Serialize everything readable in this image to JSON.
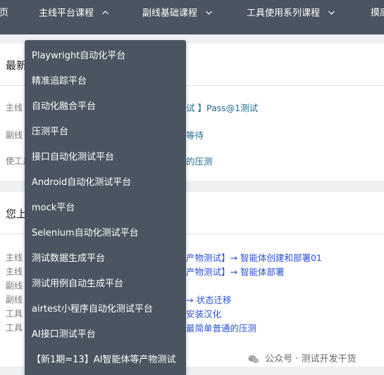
{
  "nav": {
    "items": [
      {
        "label": "页"
      },
      {
        "label": "主线平台课程",
        "chevron": "up"
      },
      {
        "label": "副线基础课程",
        "chevron": "down"
      },
      {
        "label": "工具使用系列课程",
        "chevron": "down"
      },
      {
        "label": "摸底"
      }
    ]
  },
  "panel1": {
    "title": "最新",
    "rows": [
      {
        "label": "主线",
        "link": "试 】Pass@1测试"
      },
      {
        "label": "副线",
        "link": "等待"
      },
      {
        "label": "使工具",
        "link": "的压测"
      }
    ]
  },
  "panel2": {
    "title": "您上",
    "rows": [
      {
        "label": "主线",
        "link": "产物测试】→ 智能体创建和部署01"
      },
      {
        "label": "主线",
        "link": "产物测试】→ 智能体部署"
      },
      {
        "label": "副线",
        "link": ""
      },
      {
        "label": "副线",
        "link": "→ 状态迁移"
      },
      {
        "label": "工具",
        "link": "安装汉化"
      },
      {
        "label": "工具",
        "link": "最简单普通的压测"
      }
    ]
  },
  "dropdown": {
    "items": [
      "Playwright自动化平台",
      "精准追踪平台",
      "自动化融合平台",
      "压测平台",
      "接口自动化测试平台",
      "Android自动化测试平台",
      "mock平台",
      "Selenium自动化测试平台",
      "测试数据生成平台",
      "测试用例自动生成平台",
      "airtest小程序自动化测试平台",
      "AI接口测试平台",
      "【新1期=13】AI智能体等产物测试"
    ]
  },
  "watermark": {
    "text": "公众号 · 测试开发干货"
  },
  "colors": {
    "nav_bg": "#4a5561",
    "link_teal": "#1f6b8f",
    "link_blue": "#2a4fd6"
  }
}
